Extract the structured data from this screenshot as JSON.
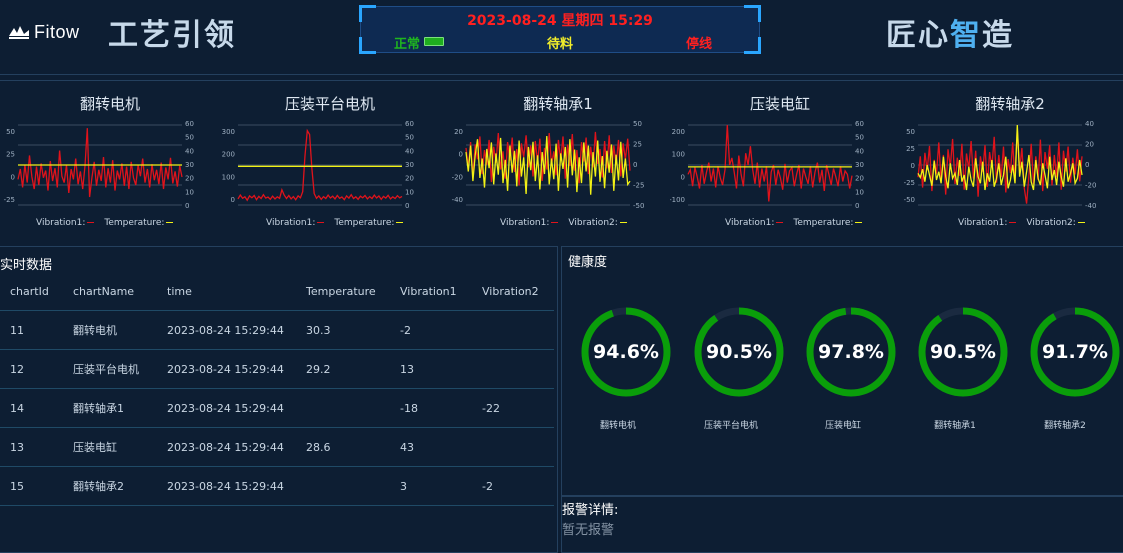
{
  "header": {
    "brand": "Fitow",
    "title_left": "工艺引领",
    "title_right_a": "匠心",
    "title_right_b": "智",
    "title_right_c": "造",
    "datetime": "2023-08-24 星期四 15:29",
    "status_normal": "正常",
    "status_waiting": "待料",
    "status_stopped": "停线"
  },
  "charts": [
    {
      "title": "翻转电机",
      "legend1": "Vibration1:",
      "legend2": "Temperature:",
      "left_ticks": [
        "50",
        "25",
        "0",
        "-25"
      ],
      "right_ticks": [
        "60",
        "50",
        "40",
        "30",
        "20",
        "10",
        "0"
      ]
    },
    {
      "title": "压装平台电机",
      "legend1": "Vibration1:",
      "legend2": "Temperature:",
      "left_ticks": [
        "300",
        "200",
        "100",
        "0"
      ],
      "right_ticks": [
        "60",
        "50",
        "40",
        "30",
        "20",
        "10",
        "0"
      ]
    },
    {
      "title": "翻转轴承1",
      "legend1": "Vibration1:",
      "legend2": "Vibration2:",
      "left_ticks": [
        "20",
        "0",
        "-20",
        "-40"
      ],
      "right_ticks": [
        "50",
        "25",
        "0",
        "-25",
        "-50"
      ]
    },
    {
      "title": "压装电缸",
      "legend1": "Vibration1:",
      "legend2": "Temperature:",
      "left_ticks": [
        "200",
        "100",
        "0",
        "-100"
      ],
      "right_ticks": [
        "60",
        "50",
        "40",
        "30",
        "20",
        "10",
        "0"
      ]
    },
    {
      "title": "翻转轴承2",
      "legend1": "Vibration1:",
      "legend2": "Vibration2:",
      "left_ticks": [
        "50",
        "25",
        "0",
        "-25",
        "-50"
      ],
      "right_ticks": [
        "40",
        "20",
        "0",
        "-20",
        "-40"
      ]
    }
  ],
  "chart_data": [
    {
      "type": "line",
      "title": "翻转电机",
      "ylim": [
        -40,
        60
      ],
      "y2lim": [
        0,
        60
      ],
      "series": [
        {
          "name": "Vibration1",
          "color": "#e0131b",
          "values": [
            -8,
            5,
            -18,
            10,
            -12,
            22,
            -5,
            -20,
            8,
            -15,
            12,
            -6,
            3,
            -22,
            15,
            -10,
            6,
            -18,
            28,
            -4,
            -12,
            10,
            -25,
            5,
            -8,
            18,
            -14,
            2,
            -20,
            9,
            56,
            -30,
            -6,
            14,
            -16,
            4,
            -10,
            20,
            -18,
            6,
            -12,
            16,
            -22,
            3,
            -8,
            12,
            -16,
            8,
            -20,
            14,
            -6,
            -15,
            10,
            -4,
            18,
            -12,
            5,
            -18,
            11,
            -9,
            4,
            -14,
            13,
            -20,
            7,
            -8,
            19,
            -13,
            2,
            -17,
            9,
            -5
          ]
        },
        {
          "name": "Temperature",
          "color": "#f2f216",
          "values": [
            30,
            30,
            30,
            30,
            30,
            30,
            30,
            30,
            30,
            30,
            30,
            30,
            30,
            30,
            30,
            30,
            30,
            30,
            30,
            30,
            30,
            30,
            30,
            30,
            30,
            30,
            30,
            30,
            30,
            30,
            30,
            30,
            30,
            30,
            30,
            30,
            30,
            30,
            30,
            30,
            30,
            30,
            30,
            30,
            30,
            30,
            30,
            30,
            30,
            30,
            30,
            30,
            30,
            30,
            30,
            30,
            30,
            30,
            30,
            30,
            30,
            30,
            30,
            30,
            30,
            30,
            30,
            30,
            30,
            30,
            30,
            30
          ]
        }
      ]
    },
    {
      "type": "line",
      "title": "压装平台电机",
      "ylim": [
        -40,
        380
      ],
      "y2lim": [
        0,
        60
      ],
      "series": [
        {
          "name": "Vibration1",
          "color": "#e0131b",
          "values": [
            -8,
            12,
            -5,
            3,
            -15,
            8,
            -2,
            10,
            -12,
            5,
            -6,
            14,
            -4,
            2,
            -10,
            6,
            -8,
            3,
            -5,
            40,
            12,
            -6,
            10,
            -8,
            4,
            -12,
            8,
            -2,
            30,
            220,
            350,
            330,
            150,
            20,
            -5,
            8,
            -10,
            4,
            -6,
            12,
            -3,
            6,
            -8,
            10,
            -5,
            2,
            -12,
            8,
            -4,
            14,
            -6,
            3,
            -10,
            6,
            -2,
            10,
            -8,
            4,
            -6,
            12,
            -3,
            7,
            -10,
            5,
            -4,
            11,
            -8,
            3,
            -6,
            9,
            -2,
            5
          ]
        },
        {
          "name": "Temperature",
          "color": "#f2f216",
          "values": [
            29,
            29,
            29,
            29,
            29,
            29,
            29,
            29,
            29,
            29,
            29,
            29,
            29,
            29,
            29,
            29,
            29,
            29,
            29,
            29,
            29,
            29,
            29,
            29,
            29,
            29,
            29,
            29,
            29,
            29,
            29,
            29,
            29,
            29,
            29,
            29,
            29,
            29,
            29,
            29,
            29,
            29,
            29,
            29,
            29,
            29,
            29,
            29,
            29,
            29,
            29,
            29,
            29,
            29,
            29,
            29,
            29,
            29,
            29,
            29,
            29,
            29,
            29,
            29,
            29,
            29,
            29,
            29,
            29,
            29,
            29,
            29
          ]
        }
      ]
    },
    {
      "type": "line",
      "title": "翻转轴承1",
      "ylim": [
        -45,
        25
      ],
      "y2lim": [
        -62,
        62
      ],
      "series": [
        {
          "name": "Vibration1",
          "color": "#e0131b",
          "values": [
            5,
            -12,
            10,
            -20,
            8,
            -5,
            15,
            -18,
            3,
            -10,
            12,
            -25,
            6,
            -8,
            18,
            -14,
            2,
            -22,
            10,
            -6,
            14,
            -16,
            4,
            -28,
            9,
            -3,
            16,
            -12,
            7,
            -20,
            11,
            -8,
            13,
            -24,
            5,
            -14,
            18,
            -10,
            2,
            -19,
            12,
            -6,
            15,
            -22,
            8,
            -11,
            17,
            -15,
            3,
            -26,
            10,
            -7,
            14,
            -18,
            6,
            -12,
            19,
            -9,
            4,
            -21,
            11,
            -13,
            16,
            -17,
            7,
            -10,
            12,
            -20,
            9,
            -5,
            13,
            -15
          ]
        },
        {
          "name": "Vibration2",
          "color": "#f2f216",
          "values": [
            20,
            -10,
            30,
            -25,
            15,
            40,
            -20,
            10,
            -35,
            25,
            -5,
            35,
            -30,
            18,
            -15,
            42,
            -28,
            8,
            -40,
            30,
            -12,
            22,
            -33,
            38,
            -18,
            12,
            -45,
            28,
            -8,
            36,
            -25,
            15,
            -38,
            20,
            -14,
            45,
            -30,
            10,
            -22,
            33,
            -40,
            18,
            -6,
            28,
            -35,
            40,
            -16,
            24,
            -42,
            12,
            -28,
            35,
            -10,
            30,
            -46,
            20,
            -18,
            38,
            -26,
            14,
            -36,
            22,
            -12,
            32,
            -40,
            16,
            -24,
            36,
            -20,
            10,
            -30,
            -25
          ]
        }
      ]
    },
    {
      "type": "line",
      "title": "压装电缸",
      "ylim": [
        -110,
        230
      ],
      "y2lim": [
        0,
        60
      ],
      "series": [
        {
          "name": "Vibration1",
          "color": "#e0131b",
          "values": [
            20,
            40,
            -30,
            50,
            10,
            -40,
            60,
            -20,
            30,
            70,
            -10,
            45,
            -35,
            55,
            5,
            -25,
            40,
            230,
            60,
            90,
            30,
            -40,
            100,
            20,
            -30,
            110,
            60,
            140,
            40,
            -20,
            70,
            -35,
            45,
            -10,
            55,
            -95,
            30,
            60,
            -25,
            40,
            5,
            -45,
            65,
            -15,
            35,
            50,
            -30,
            20,
            60,
            -40,
            45,
            10,
            -20,
            55,
            -35,
            30,
            70,
            -15,
            40,
            -50,
            60,
            20,
            -25,
            45,
            10,
            -30,
            55,
            -10,
            35,
            20,
            -40,
            15
          ]
        },
        {
          "name": "Temperature",
          "color": "#f2f216",
          "values": [
            28.6,
            28.6,
            28.6,
            28.6,
            28.6,
            28.6,
            28.6,
            28.6,
            28.6,
            28.6,
            28.6,
            28.6,
            28.6,
            28.6,
            28.6,
            28.6,
            28.6,
            28.6,
            28.6,
            28.6,
            28.6,
            28.6,
            28.6,
            28.6,
            28.6,
            28.6,
            28.6,
            28.6,
            28.6,
            28.6,
            28.6,
            28.6,
            28.6,
            28.6,
            28.6,
            28.6,
            28.6,
            28.6,
            28.6,
            28.6,
            28.6,
            28.6,
            28.6,
            28.6,
            28.6,
            28.6,
            28.6,
            28.6,
            28.6,
            28.6,
            28.6,
            28.6,
            28.6,
            28.6,
            28.6,
            28.6,
            28.6,
            28.6,
            28.6,
            28.6,
            28.6,
            28.6,
            28.6,
            28.6,
            28.6,
            28.6,
            28.6,
            28.6,
            28.6,
            28.6,
            28.6,
            28.6
          ]
        }
      ]
    },
    {
      "type": "line",
      "title": "翻转轴承2",
      "ylim": [
        -60,
        55
      ],
      "y2lim": [
        -48,
        48
      ],
      "series": [
        {
          "name": "Vibration1",
          "color": "#e0131b",
          "values": [
            -20,
            10,
            -35,
            15,
            -10,
            25,
            -40,
            5,
            -15,
            30,
            -25,
            12,
            -45,
            20,
            -5,
            35,
            -30,
            8,
            -18,
            28,
            -38,
            14,
            -8,
            32,
            -22,
            18,
            -48,
            10,
            -12,
            26,
            -34,
            16,
            -6,
            38,
            -28,
            12,
            -20,
            24,
            -42,
            6,
            -14,
            30,
            -26,
            50,
            -10,
            22,
            -36,
            -58,
            -18,
            28,
            -30,
            10,
            -24,
            34,
            -40,
            16,
            -8,
            26,
            -32,
            12,
            -20,
            30,
            -38,
            18,
            -12,
            24,
            -28,
            8,
            -16,
            20,
            -26,
            10
          ]
        },
        {
          "name": "Vibration2",
          "color": "#f2f216",
          "values": [
            -10,
            -15,
            -5,
            -20,
            0,
            -12,
            -25,
            5,
            -18,
            -8,
            -22,
            10,
            -14,
            -28,
            2,
            -16,
            -10,
            -24,
            6,
            -20,
            -12,
            -30,
            -2,
            -18,
            -26,
            8,
            -14,
            -22,
            4,
            -30,
            -10,
            -20,
            6,
            -26,
            -16,
            2,
            -24,
            -12,
            10,
            -28,
            -18,
            0,
            -22,
            48,
            -14,
            4,
            -26,
            -8,
            12,
            -20,
            -30,
            6,
            -16,
            -24,
            2,
            -12,
            -28,
            10,
            -18,
            -6,
            -24,
            4,
            -14,
            -26,
            8,
            -20,
            -10,
            2,
            -22,
            -16,
            6,
            -12
          ]
        }
      ]
    }
  ],
  "realtime": {
    "title": "实时数据",
    "columns": [
      "chartId",
      "chartName",
      "time",
      "Temperature",
      "Vibration1",
      "Vibration2"
    ],
    "rows": [
      [
        "11",
        "翻转电机",
        "2023-08-24 15:29:44",
        "30.3",
        "-2",
        ""
      ],
      [
        "12",
        "压装平台电机",
        "2023-08-24 15:29:44",
        "29.2",
        "13",
        ""
      ],
      [
        "14",
        "翻转轴承1",
        "2023-08-24 15:29:44",
        "",
        "-18",
        "-22"
      ],
      [
        "13",
        "压装电缸",
        "2023-08-24 15:29:44",
        "28.6",
        "43",
        ""
      ],
      [
        "15",
        "翻转轴承2",
        "2023-08-24 15:29:44",
        "",
        "3",
        "-2"
      ]
    ]
  },
  "health": {
    "title": "健康度",
    "color": "#0a9e0a",
    "gauges": [
      {
        "value": "94.6%",
        "fraction": 0.946,
        "label": "翻转电机"
      },
      {
        "value": "90.5%",
        "fraction": 0.905,
        "label": "压装平台电机"
      },
      {
        "value": "97.8%",
        "fraction": 0.978,
        "label": "压装电缸"
      },
      {
        "value": "90.5%",
        "fraction": 0.905,
        "label": "翻转轴承1"
      },
      {
        "value": "91.7%",
        "fraction": 0.917,
        "label": "翻转轴承2"
      }
    ]
  },
  "alarm": {
    "title": "报警详情:",
    "text": "暂无报警"
  }
}
